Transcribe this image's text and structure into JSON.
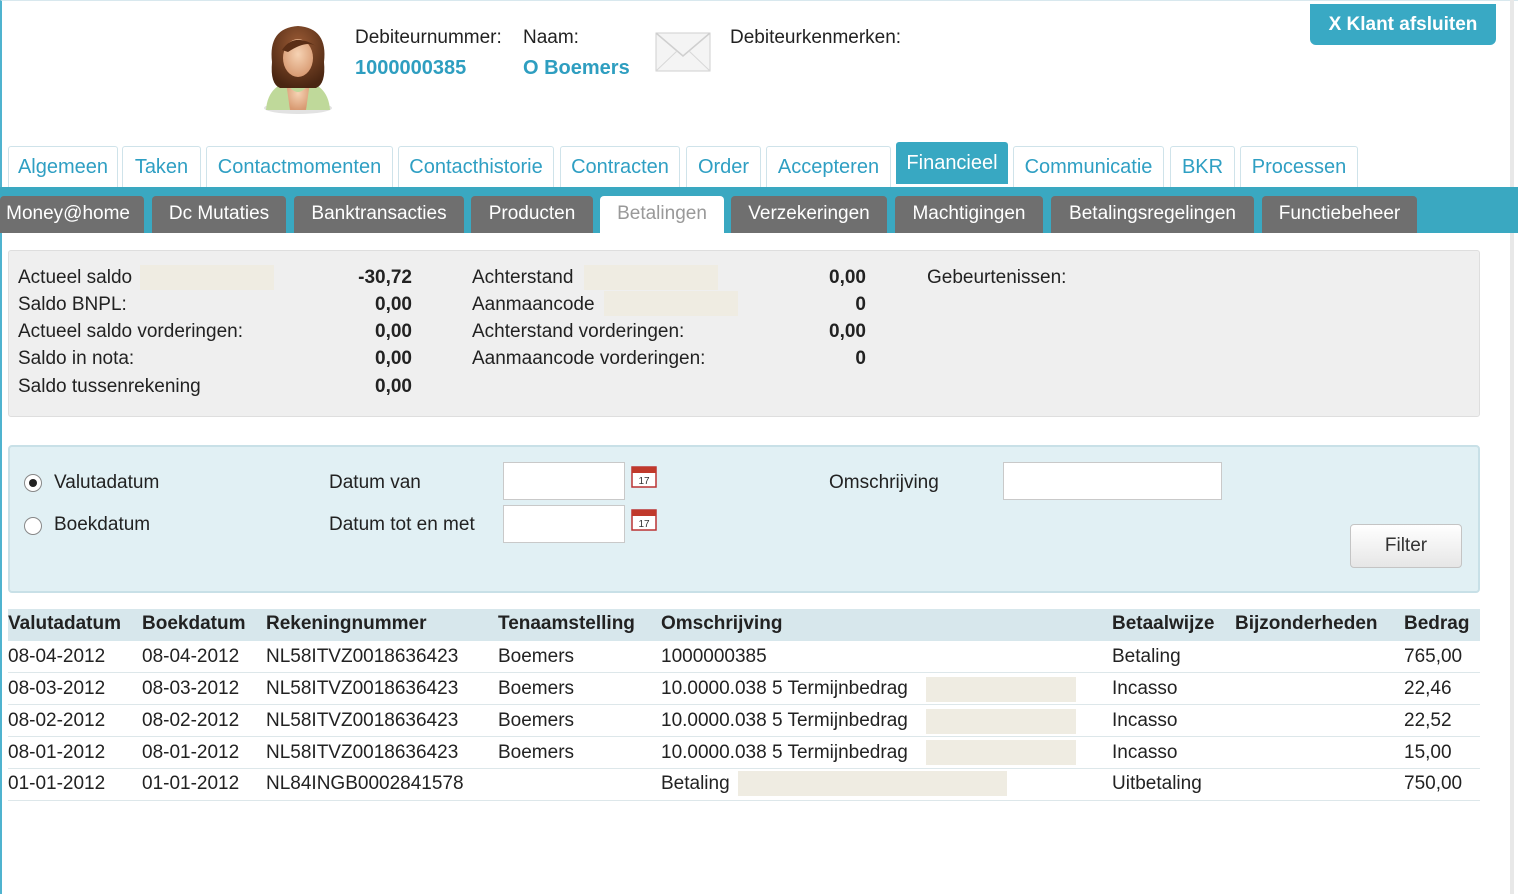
{
  "header": {
    "debtor_number_label": "Debiteurnummer:",
    "debtor_number": "1000000385",
    "name_label": "Naam:",
    "name": "O Boemers",
    "characteristics_label": "Debiteurkenmerken:",
    "close_button": "X Klant afsluiten"
  },
  "tabs": [
    "Algemeen",
    "Taken",
    "Contactmomenten",
    "Contacthistorie",
    "Contracten",
    "Order",
    "Accepteren",
    "Financieel",
    "Communicatie",
    "BKR",
    "Processen"
  ],
  "active_tab": "Financieel",
  "subtabs": [
    "Money@home",
    "Dc Mutaties",
    "Banktransacties",
    "Producten",
    "Betalingen",
    "Verzekeringen",
    "Machtigingen",
    "Betalingsregelingen",
    "Functiebeheer"
  ],
  "active_subtab": "Betalingen",
  "summary": {
    "left": [
      {
        "label": "Actueel saldo",
        "value": "-30,72"
      },
      {
        "label": "Saldo BNPL:",
        "value": "0,00"
      },
      {
        "label": "Actueel saldo vorderingen:",
        "value": "0,00"
      },
      {
        "label": "Saldo in nota:",
        "value": "0,00"
      },
      {
        "label": "Saldo tussenrekening",
        "value": "0,00"
      }
    ],
    "middle": [
      {
        "label": "Achterstand",
        "value": "0,00"
      },
      {
        "label": "Aanmaancode",
        "value": "0"
      },
      {
        "label": "Achterstand vorderingen:",
        "value": "0,00"
      },
      {
        "label": "Aanmaancode vorderingen:",
        "value": "0"
      }
    ],
    "events_label": "Gebeurtenissen:"
  },
  "filter": {
    "radio_value_date": "Valutadatum",
    "radio_book_date": "Boekdatum",
    "selected_radio": "Valutadatum",
    "date_from_label": "Datum van",
    "date_to_label": "Datum tot en met",
    "description_label": "Omschrijving",
    "date_from_value": "",
    "date_to_value": "",
    "description_value": "",
    "filter_button": "Filter"
  },
  "table": {
    "columns": [
      "Valutadatum",
      "Boekdatum",
      "Rekeningnummer",
      "Tenaamstelling",
      "Omschrijving",
      "Betaalwijze",
      "Bijzonderheden",
      "Bedrag"
    ],
    "rows": [
      [
        "08-04-2012",
        "08-04-2012",
        "NL58ITVZ0018636423",
        "Boemers",
        "1000000385",
        "Betaling",
        "",
        "765,00"
      ],
      [
        "08-03-2012",
        "08-03-2012",
        "NL58ITVZ0018636423",
        "Boemers",
        "10.0000.038 5 Termijnbedrag",
        "Incasso",
        "",
        "22,46"
      ],
      [
        "08-02-2012",
        "08-02-2012",
        "NL58ITVZ0018636423",
        "Boemers",
        "10.0000.038 5 Termijnbedrag",
        "Incasso",
        "",
        "22,52"
      ],
      [
        "08-01-2012",
        "08-01-2012",
        "NL58ITVZ0018636423",
        "Boemers",
        "10.0000.038 5 Termijnbedrag",
        "Incasso",
        "",
        "15,00"
      ],
      [
        "01-01-2012",
        "01-01-2012",
        "NL84INGB0002841578",
        "",
        "Betaling",
        "Uitbetaling",
        "",
        "750,00"
      ]
    ]
  },
  "colors": {
    "accent": "#39a9c4",
    "link": "#2e9ec0",
    "subtab": "#6f6f6f",
    "filter_panel": "#e1f0f4"
  }
}
